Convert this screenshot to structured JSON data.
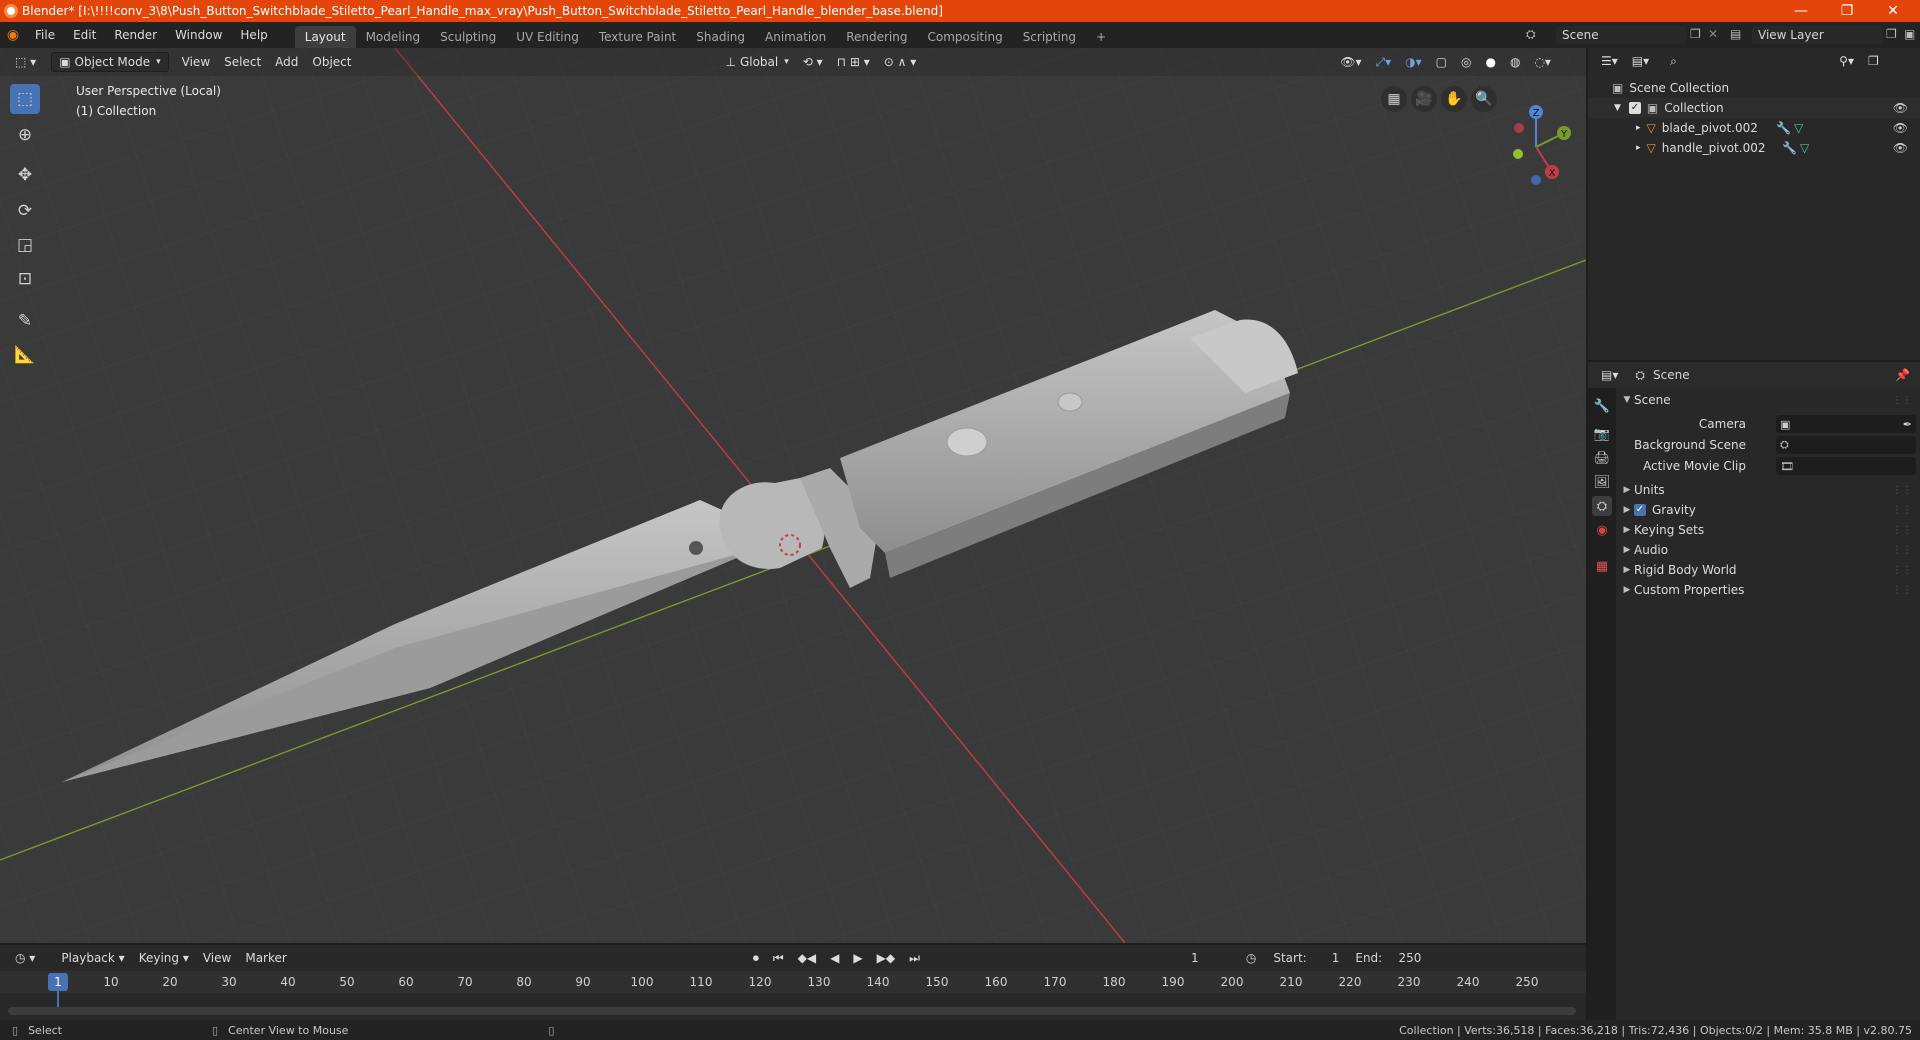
{
  "window": {
    "title": "Blender* [I:\\!!!!conv_3\\8\\Push_Button_Switchblade_Stiletto_Pearl_Handle_max_vray\\Push_Button_Switchblade_Stiletto_Pearl_Handle_blender_base.blend]",
    "minimize": "—",
    "maximize": "❐",
    "close": "✕"
  },
  "menubar": {
    "items": [
      "File",
      "Edit",
      "Render",
      "Window",
      "Help"
    ],
    "workspaces": [
      "Layout",
      "Modeling",
      "Sculpting",
      "UV Editing",
      "Texture Paint",
      "Shading",
      "Animation",
      "Rendering",
      "Compositing",
      "Scripting"
    ],
    "active_workspace": "Layout",
    "add_tab": "+",
    "scene_name": "Scene",
    "view_layer": "View Layer"
  },
  "viewport": {
    "mode": "Object Mode",
    "menus": [
      "View",
      "Select",
      "Add",
      "Object"
    ],
    "orientation": "Global",
    "overlay_line1": "User Perspective (Local)",
    "overlay_line2": "(1) Collection",
    "gizmo": {
      "x": "X",
      "y": "Y",
      "z": "Z"
    },
    "colors": {
      "x_axis": "#c33b48",
      "y_axis": "#7b9a2a",
      "accent": "#4772b3"
    }
  },
  "timeline": {
    "menus": [
      "Playback",
      "Keying",
      "View",
      "Marker"
    ],
    "current_frame": "1",
    "start_label": "Start:",
    "start": "1",
    "end_label": "End:",
    "end": "250",
    "ticks": [
      "1",
      "10",
      "20",
      "30",
      "40",
      "50",
      "60",
      "70",
      "80",
      "90",
      "100",
      "110",
      "120",
      "130",
      "140",
      "150",
      "160",
      "170",
      "180",
      "190",
      "200",
      "210",
      "220",
      "230",
      "240",
      "250"
    ]
  },
  "outliner": {
    "root": "Scene Collection",
    "collection": "Collection",
    "objects": [
      "blade_pivot.002",
      "handle_pivot.002"
    ]
  },
  "properties": {
    "context": "Scene",
    "panel_title": "Scene",
    "camera_label": "Camera",
    "background_scene_label": "Background Scene",
    "active_movie_clip_label": "Active Movie Clip",
    "sections": [
      "Units",
      "Gravity",
      "Keying Sets",
      "Audio",
      "Rigid Body World",
      "Custom Properties"
    ],
    "gravity_checked": true
  },
  "statusbar": {
    "select": "Select",
    "center_view": "Center View to Mouse",
    "stats": "Collection | Verts:36,518 | Faces:36,218 | Tris:72,436 | Objects:0/2 | Mem: 35.8 MB | v2.80.75"
  }
}
